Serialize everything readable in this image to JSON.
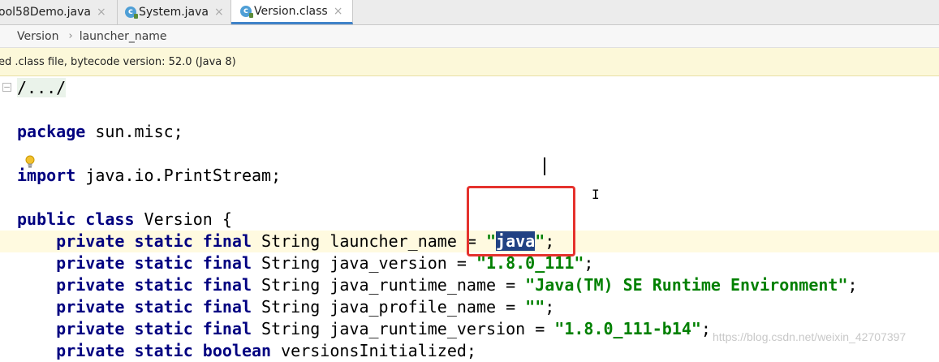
{
  "tabs": [
    {
      "label": "ool58Demo.java",
      "icon": "java-file-icon",
      "active": false
    },
    {
      "label": "System.java",
      "icon": "class-c-icon",
      "active": false
    },
    {
      "label": "Version.class",
      "icon": "class-c-icon",
      "active": true
    }
  ],
  "breadcrumb": {
    "items": [
      "Version",
      "launcher_name"
    ]
  },
  "notice": {
    "text": "ed .class file, bytecode version: 52.0 (Java 8)"
  },
  "code": {
    "fold_line": "/.../",
    "package_kw": "package",
    "package_name": " sun.misc;",
    "import_kw": "import",
    "import_name": " java.io.PrintStream;",
    "class_kw1": "public",
    "class_kw2": "class",
    "class_name": " Version {",
    "fields": [
      {
        "mods": "private static final",
        "type": " String ",
        "name": "launcher_name = ",
        "value": "java",
        "tail": ";"
      },
      {
        "mods": "private static final",
        "type": " String ",
        "name": "java_version = ",
        "value": "\"1.8.0_111\"",
        "tail": ";"
      },
      {
        "mods": "private static final",
        "type": " String ",
        "name": "java_runtime_name = ",
        "value": "\"Java(TM) SE Runtime Environment\"",
        "tail": ";"
      },
      {
        "mods": "private static final",
        "type": " String ",
        "name": "java_profile_name = ",
        "value": "\"\"",
        "tail": ";"
      },
      {
        "mods": "private static final",
        "type": " String ",
        "name": "java_runtime_version = ",
        "value": "\"1.8.0_111-b14\"",
        "tail": ";"
      }
    ],
    "last_mods": "private static boolean",
    "last_rest": " versionsInitialized;"
  },
  "watermark": "https://blog.csdn.net/weixin_42707397",
  "colors": {
    "keyword": "#000080",
    "string": "#008000",
    "selection": "#214283",
    "highlight_box": "#e5322d"
  }
}
